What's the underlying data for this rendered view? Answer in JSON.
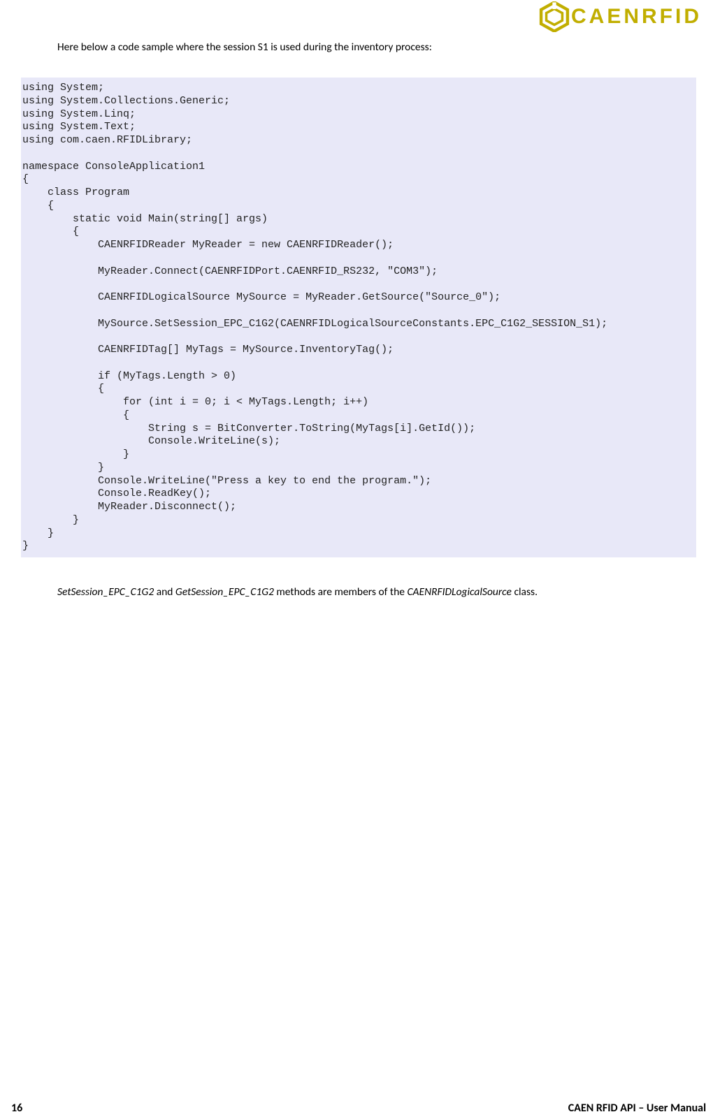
{
  "header": {
    "brand": "CAENRFID"
  },
  "intro_text": "Here below a code sample where the session S1 is used during the inventory process:",
  "code": "using System;\nusing System.Collections.Generic;\nusing System.Linq;\nusing System.Text;\nusing com.caen.RFIDLibrary;\n\nnamespace ConsoleApplication1\n{\n    class Program\n    {\n        static void Main(string[] args)\n        {\n            CAENRFIDReader MyReader = new CAENRFIDReader();\n\n            MyReader.Connect(CAENRFIDPort.CAENRFID_RS232, \"COM3\");\n\n            CAENRFIDLogicalSource MySource = MyReader.GetSource(\"Source_0\");\n\n            MySource.SetSession_EPC_C1G2(CAENRFIDLogicalSourceConstants.EPC_C1G2_SESSION_S1);\n\n            CAENRFIDTag[] MyTags = MySource.InventoryTag();\n\n            if (MyTags.Length > 0)\n            {\n                for (int i = 0; i < MyTags.Length; i++)\n                {\n                    String s = BitConverter.ToString(MyTags[i].GetId());\n                    Console.WriteLine(s);\n                }\n            }\n            Console.WriteLine(\"Press a key to end the program.\");\n            Console.ReadKey();\n            MyReader.Disconnect();\n        }\n    }\n}",
  "outro": {
    "m1": "SetSession_EPC_C1G2",
    "and": " and ",
    "m2": "GetSession_EPC_C1G2",
    "mid": " methods are members of the ",
    "cls": "CAENRFIDLogicalSource",
    "end": " class."
  },
  "footer": {
    "page": "16",
    "title": "CAEN RFID API – User Manual"
  }
}
